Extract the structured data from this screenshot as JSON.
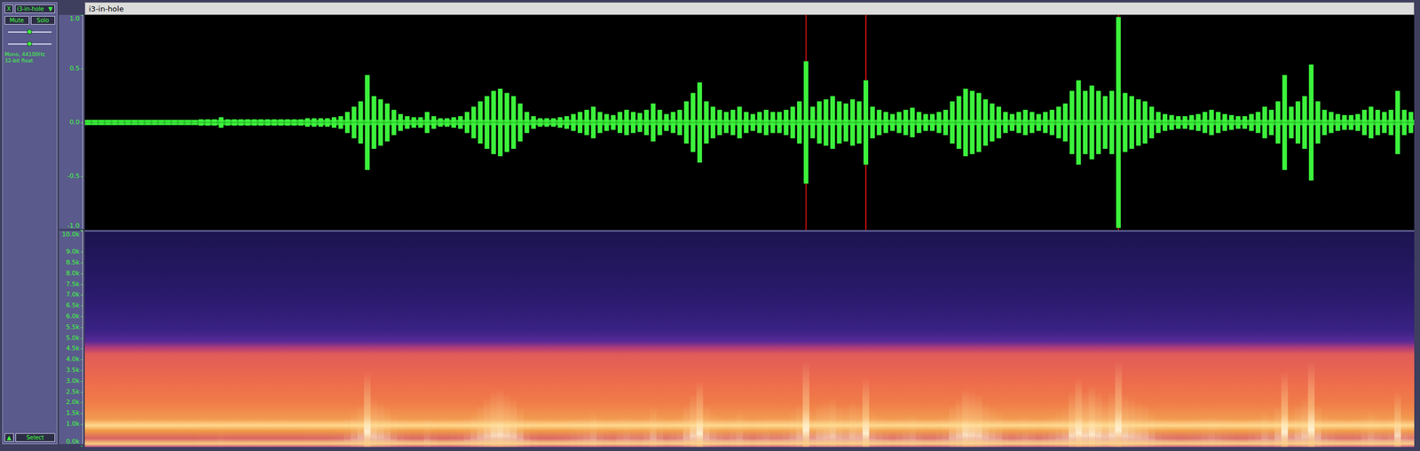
{
  "track": {
    "name": "i3-in-hole",
    "close": "X",
    "menu_arrow": "▼",
    "mute": {
      "label": "Mute",
      "selected": false
    },
    "solo": {
      "label": "Solo",
      "selected": false
    },
    "gain": {
      "level": 0.5
    },
    "pan": {
      "level": 0.5
    },
    "info": [
      "Mono, 44100Hz",
      "32-bit float"
    ],
    "collapse": "▲",
    "select": "Select"
  },
  "title": "i3-in-hole",
  "waveform": {
    "ticks": [
      "1.0",
      "0.5",
      "0.0",
      "-0.5",
      "-1.0"
    ],
    "peaks": [
      0.02,
      0.02,
      0.02,
      0.02,
      0.02,
      0.02,
      0.02,
      0.02,
      0.02,
      0.02,
      0.02,
      0.02,
      0.02,
      0.02,
      0.02,
      0.02,
      0.02,
      0.03,
      0.03,
      0.03,
      0.05,
      0.03,
      0.03,
      0.03,
      0.03,
      0.03,
      0.03,
      0.03,
      0.03,
      0.03,
      0.03,
      0.03,
      0.03,
      0.04,
      0.04,
      0.04,
      0.04,
      0.05,
      0.06,
      0.1,
      0.15,
      0.2,
      0.45,
      0.25,
      0.22,
      0.18,
      0.12,
      0.08,
      0.06,
      0.05,
      0.05,
      0.1,
      0.06,
      0.04,
      0.04,
      0.05,
      0.06,
      0.1,
      0.15,
      0.2,
      0.25,
      0.3,
      0.32,
      0.28,
      0.25,
      0.18,
      0.1,
      0.06,
      0.04,
      0.04,
      0.04,
      0.05,
      0.06,
      0.08,
      0.1,
      0.12,
      0.15,
      0.1,
      0.08,
      0.07,
      0.1,
      0.12,
      0.1,
      0.09,
      0.12,
      0.18,
      0.12,
      0.08,
      0.1,
      0.12,
      0.2,
      0.28,
      0.38,
      0.2,
      0.15,
      0.12,
      0.1,
      0.12,
      0.15,
      0.1,
      0.08,
      0.1,
      0.12,
      0.1,
      0.1,
      0.12,
      0.15,
      0.2,
      0.58,
      0.15,
      0.2,
      0.22,
      0.25,
      0.2,
      0.18,
      0.22,
      0.2,
      0.4,
      0.15,
      0.12,
      0.1,
      0.08,
      0.1,
      0.12,
      0.14,
      0.1,
      0.08,
      0.08,
      0.1,
      0.12,
      0.2,
      0.25,
      0.32,
      0.3,
      0.28,
      0.22,
      0.18,
      0.15,
      0.1,
      0.08,
      0.1,
      0.12,
      0.1,
      0.08,
      0.1,
      0.12,
      0.15,
      0.18,
      0.3,
      0.4,
      0.3,
      0.35,
      0.3,
      0.25,
      0.3,
      1.0,
      0.28,
      0.25,
      0.22,
      0.2,
      0.15,
      0.1,
      0.08,
      0.07,
      0.06,
      0.06,
      0.07,
      0.08,
      0.1,
      0.12,
      0.1,
      0.08,
      0.07,
      0.06,
      0.06,
      0.08,
      0.1,
      0.15,
      0.12,
      0.2,
      0.45,
      0.15,
      0.2,
      0.25,
      0.55,
      0.2,
      0.12,
      0.1,
      0.08,
      0.07,
      0.07,
      0.08,
      0.12,
      0.15,
      0.12,
      0.1,
      0.12,
      0.3,
      0.12,
      0.1
    ],
    "clip_indices": [
      108,
      117,
      155
    ]
  },
  "spectrogram": {
    "ticks": [
      "10.0k",
      "9.0k",
      "8.5k",
      "8.0k",
      "7.5k",
      "7.0k",
      "6.5k",
      "6.0k",
      "5.5k",
      "5.0k",
      "4.5k",
      "4.0k",
      "3.5k",
      "3.0k",
      "2.5k",
      "2.0k",
      "1.5k",
      "1.0k",
      "0.0k"
    ]
  }
}
